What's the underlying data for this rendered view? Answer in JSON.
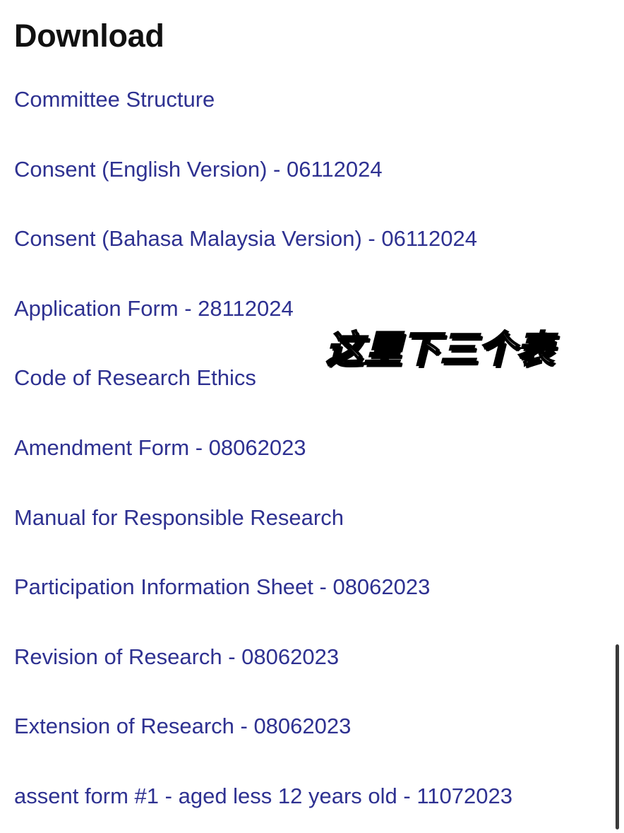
{
  "header": {
    "title": "Download"
  },
  "downloads": [
    {
      "label": "Committee Structure"
    },
    {
      "label": "Consent (English Version) - 06112024"
    },
    {
      "label": "Consent (Bahasa Malaysia Version) - 06112024"
    },
    {
      "label": "Application Form - 28112024"
    },
    {
      "label": "Code of Research Ethics"
    },
    {
      "label": "Amendment Form - 08062023"
    },
    {
      "label": "Manual for Responsible Research"
    },
    {
      "label": "Participation Information Sheet - 08062023"
    },
    {
      "label": "Revision of Research - 08062023"
    },
    {
      "label": "Extension of Research - 08062023"
    },
    {
      "label": "assent form #1 - aged less 12 years old - 11072023"
    }
  ],
  "overlay": {
    "caption": "这里下三个表"
  },
  "colors": {
    "link": "#2e3191",
    "title": "#111111",
    "background": "#ffffff",
    "scrollbar": "#3a3a3a"
  }
}
